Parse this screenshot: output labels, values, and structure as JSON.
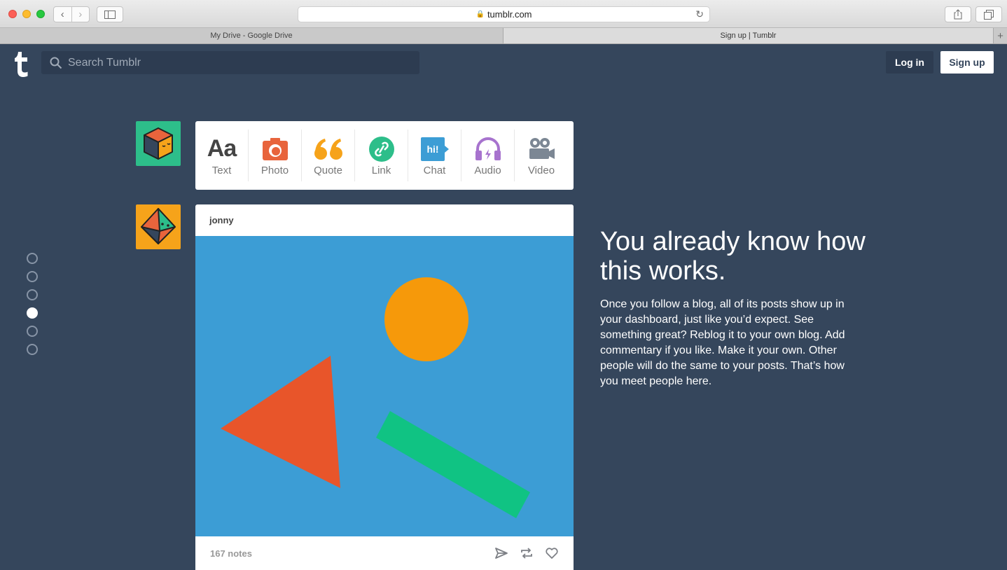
{
  "browser": {
    "url": "tumblr.com",
    "tabs": [
      {
        "label": "My Drive - Google Drive"
      },
      {
        "label": "Sign up | Tumblr"
      }
    ]
  },
  "header": {
    "search_placeholder": "Search Tumblr",
    "login_label": "Log in",
    "signup_label": "Sign up"
  },
  "post_types": [
    {
      "label": "Text",
      "icon": "text-icon",
      "color": "#444444"
    },
    {
      "label": "Photo",
      "icon": "camera-icon",
      "color": "#e8643c"
    },
    {
      "label": "Quote",
      "icon": "quote-icon",
      "color": "#f6a31a"
    },
    {
      "label": "Link",
      "icon": "link-icon",
      "color": "#2dbe8a"
    },
    {
      "label": "Chat",
      "icon": "chat-icon",
      "color": "#3c9dd5"
    },
    {
      "label": "Audio",
      "icon": "headphones-icon",
      "color": "#a773ce"
    },
    {
      "label": "Video",
      "icon": "video-camera-icon",
      "color": "#7c8794"
    }
  ],
  "post": {
    "author": "jonny",
    "notes": "167 notes",
    "image_bg": "#3c9dd5"
  },
  "dots": {
    "count": 6,
    "active_index": 3
  },
  "content": {
    "headline": "You already know how this works.",
    "body": "Once you follow a blog, all of its posts show up in your dashboard, just like you’d expect. See something great? Reblog it to your own blog. Add commentary if you like. Make it your own. Other people will do the same to your posts. That’s how you meet people here."
  },
  "colors": {
    "background": "#35465c",
    "search_bg": "#2d3c51"
  }
}
